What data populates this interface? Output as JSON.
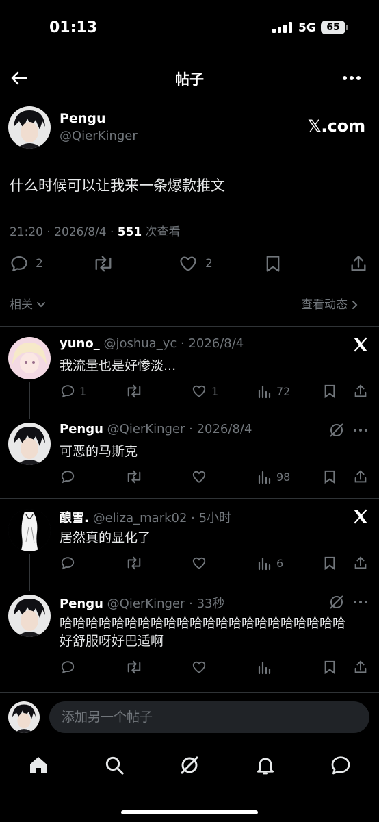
{
  "status": {
    "time": "01:13",
    "network": "5G",
    "battery": "65"
  },
  "header": {
    "title": "帖子"
  },
  "post": {
    "author_name": "Pengu",
    "author_handle": "@QierKinger",
    "source_logo": "𝕏.com",
    "text": "什么时候可以让我来一条爆款推文",
    "timestamp": "21:20 · 2026/8/4 · ",
    "views_count": "551",
    "views_label": " 次查看",
    "replies": "2",
    "likes": "2"
  },
  "section": {
    "related_label": "相关",
    "activity_label": "查看动态"
  },
  "replies": [
    {
      "name": "yuno_",
      "meta": "@joshua_yc · 2026/8/4",
      "text": "我流量也是好惨淡...",
      "replies": "1",
      "likes": "1",
      "views": "72",
      "icon": "x-logo-icon"
    },
    {
      "name": "Pengu",
      "meta": "@QierKinger · 2026/8/4",
      "text": "可恶的马斯克",
      "replies": "",
      "likes": "",
      "views": "98",
      "icon": "grok-icon"
    },
    {
      "name": "酿雪.",
      "meta": "@eliza_mark02 · 5小时",
      "text": "居然真的显化了",
      "replies": "",
      "likes": "",
      "views": "6",
      "icon": "x-logo-icon"
    },
    {
      "name": "Pengu",
      "meta": "@QierKinger · 33秒",
      "text": "哈哈哈哈哈哈哈哈哈哈哈哈哈哈哈哈哈哈哈哈哈哈好舒服呀好巴适啊",
      "replies": "",
      "likes": "",
      "views": "",
      "icon": "grok-icon"
    }
  ],
  "compose": {
    "placeholder": "添加另一个帖子"
  },
  "nav": [
    "home-icon",
    "search-icon",
    "grok-icon",
    "notifications-icon",
    "messages-icon"
  ],
  "colors": {
    "background": "#000000",
    "text": "#e7e9ea",
    "muted": "#71767b",
    "divider": "#2f3336"
  }
}
